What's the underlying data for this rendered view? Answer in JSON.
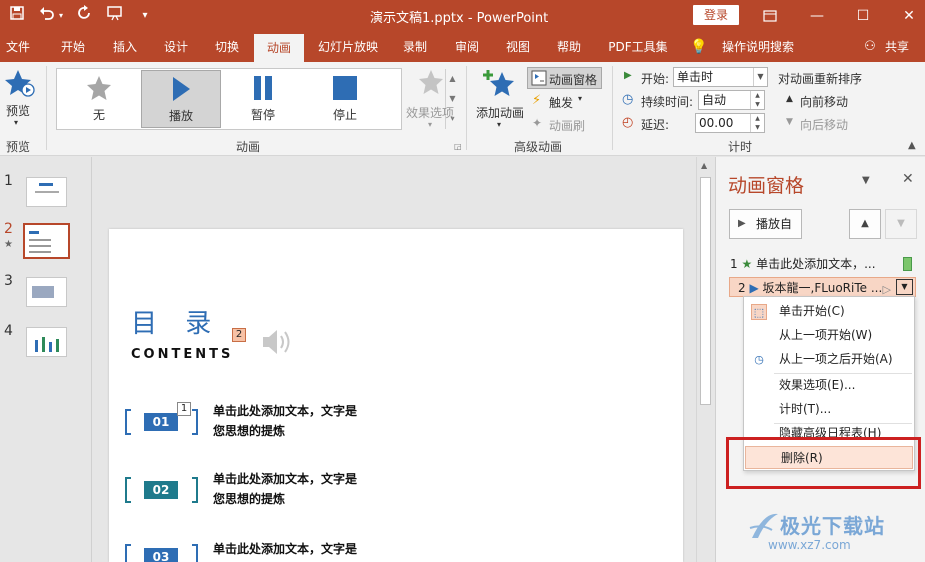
{
  "titlebar": {
    "doc_title": "演示文稿1.pptx  -  PowerPoint",
    "login_label": "登录",
    "save_icon": "save-icon",
    "undo_icon": "undo-icon",
    "redo_icon": "redo-icon",
    "present_icon": "present-from-start-icon",
    "customize_icon": "customize-quick-access-icon"
  },
  "tabs": [
    {
      "label": "文件"
    },
    {
      "label": "开始"
    },
    {
      "label": "插入"
    },
    {
      "label": "设计"
    },
    {
      "label": "切换"
    },
    {
      "label": "动画"
    },
    {
      "label": "幻灯片放映"
    },
    {
      "label": "录制"
    },
    {
      "label": "审阅"
    },
    {
      "label": "视图"
    },
    {
      "label": "帮助"
    },
    {
      "label": "PDF工具集"
    },
    {
      "label": "操作说明搜索"
    },
    {
      "label": "共享"
    }
  ],
  "ribbon": {
    "preview": {
      "label": "预览",
      "group": "预览"
    },
    "animation": {
      "group": "动画",
      "items": [
        {
          "label": "无"
        },
        {
          "label": "播放"
        },
        {
          "label": "暂停"
        },
        {
          "label": "停止"
        }
      ],
      "effect_options": "效果选项"
    },
    "advanced": {
      "group": "高级动画",
      "add_animation": "添加动画",
      "animation_pane": "动画窗格",
      "trigger": "触发",
      "animation_painter": "动画刷"
    },
    "timing": {
      "group": "计时",
      "start_label": "开始:",
      "start_value": "单击时",
      "duration_label": "持续时间:",
      "duration_value": "自动",
      "delay_label": "延迟:",
      "delay_value": "00.00",
      "reorder_label": "对动画重新排序",
      "move_earlier": "向前移动",
      "move_later": "向后移动"
    }
  },
  "thumbnails": [
    {
      "number": "1"
    },
    {
      "number": "2"
    },
    {
      "number": "3"
    },
    {
      "number": "4"
    }
  ],
  "slide": {
    "title": "目 录",
    "subtitle": "CONTENTS",
    "tag_title": "2",
    "tag_item1": "1",
    "items": [
      {
        "badge": "01",
        "line1": "单击此处添加文本，文字是",
        "line2": "您思想的提炼",
        "color": "#2e6db4"
      },
      {
        "badge": "02",
        "line1": "单击此处添加文本，文字是",
        "line2": "您思想的提炼",
        "color": "#1f7a8c"
      },
      {
        "badge": "03",
        "line1": "单击此处添加文本，文字是",
        "line2": "",
        "color": "#2e6db4"
      }
    ]
  },
  "animation_pane": {
    "title": "动画窗格",
    "play_from": "播放自",
    "list": [
      {
        "index": "1",
        "text": "单击此处添加文本，..."
      },
      {
        "index": "2",
        "text": "坂本龍一,FLuoRiTe ..."
      }
    ],
    "context_menu": [
      {
        "label": "单击开始(C)"
      },
      {
        "label": "从上一项开始(W)"
      },
      {
        "label": "从上一项之后开始(A)"
      },
      {
        "label": "效果选项(E)..."
      },
      {
        "label": "计时(T)..."
      },
      {
        "label": "隐藏高级日程表(H)"
      },
      {
        "label": "删除(R)"
      }
    ]
  },
  "watermark": {
    "brand": "极光下载站",
    "url": "www.xz7.com"
  },
  "colors": {
    "accent": "#b7472a",
    "title_blue": "#2e6db4",
    "highlight_red": "#cc2020"
  }
}
